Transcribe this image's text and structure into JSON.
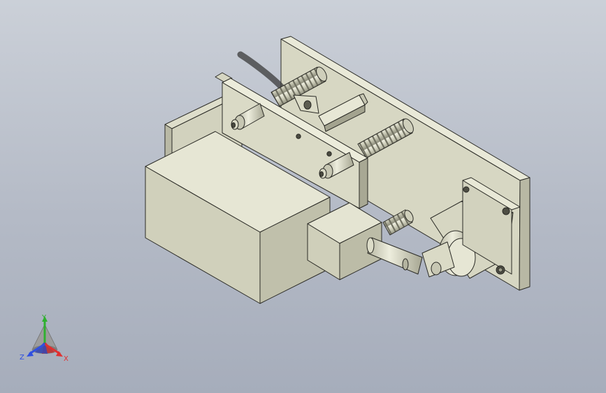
{
  "viewport": {
    "background_top": "#cbd0d8",
    "background_bottom": "#a6adbb",
    "part_color": "#d9d9c5"
  },
  "triad": {
    "x_label": "X",
    "y_label": "Y",
    "z_label": "Z",
    "x_color": "#e03030",
    "y_color": "#2fb02f",
    "z_color": "#3050e0"
  }
}
